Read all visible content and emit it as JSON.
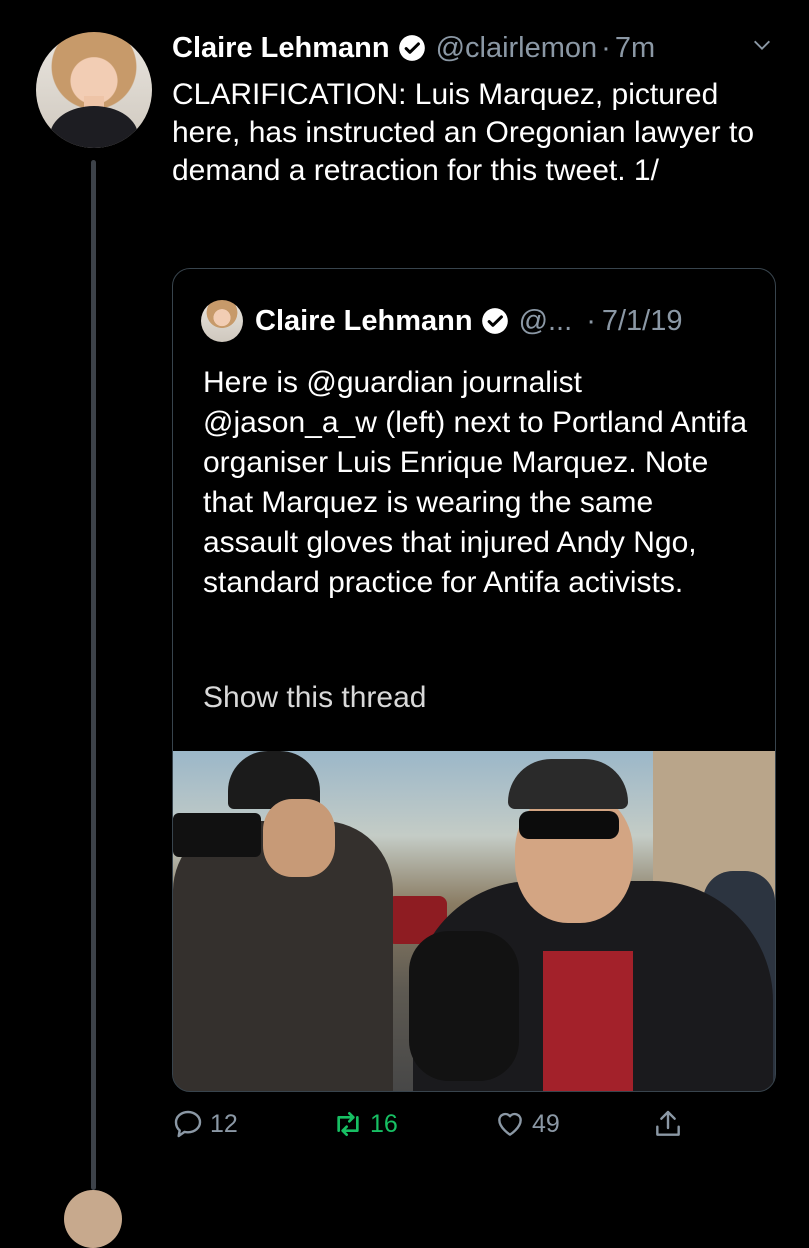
{
  "tweet": {
    "author_name": "Claire Lehmann",
    "handle": "@clairlemon",
    "separator": "·",
    "time": "7m",
    "text": "CLARIFICATION: Luis Marquez, pictured here, has instructed an Oregonian lawyer to demand a retraction for this tweet. 1/",
    "icons": {
      "verified": "verified-badge-icon",
      "menu": "chevron-down-icon"
    }
  },
  "quoted_tweet": {
    "author_name": "Claire Lehmann",
    "handle": "@...",
    "separator": "·",
    "time": "7/1/19",
    "text": "Here is @guardian journalist @jason_a_w (left) next to Portland Antifa organiser Luis Enrique Marquez. Note that Marquez is wearing the same assault gloves that injured Andy Ngo, standard practice for Antifa activists.",
    "show_thread": "Show this thread"
  },
  "actions": {
    "reply_count": "12",
    "retweet_count": "16",
    "like_count": "49",
    "icons": [
      "reply-icon",
      "retweet-icon",
      "like-icon",
      "share-icon"
    ]
  },
  "colors": {
    "background": "#000000",
    "text": "#ffffff",
    "secondary": "#8b98a5",
    "retweet_active": "#17bf63",
    "border": "#38444d"
  }
}
